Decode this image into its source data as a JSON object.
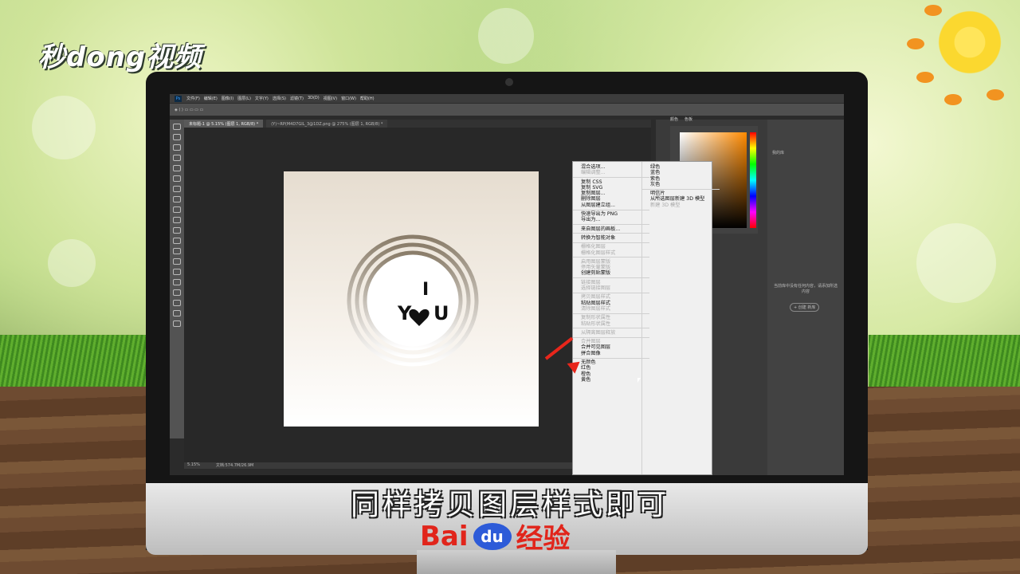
{
  "watermark": {
    "logo": "秒dong视频",
    "baidu_text": "Bai",
    "baidu_paw": "du",
    "baidu_suffix": "经验"
  },
  "subtitle": "同样拷贝图层样式即可",
  "photoshop": {
    "menubar": [
      "文件(F)",
      "编辑(E)",
      "图像(I)",
      "图层(L)",
      "文字(Y)",
      "选择(S)",
      "滤镜(T)",
      "3D(D)",
      "视图(V)",
      "窗口(W)",
      "帮助(H)"
    ],
    "tabs": [
      "未标题-1 @ 5.15% (图层 1, RGB/8) *",
      "(Y)~RP(M4D7GIL_3@1DZ.png @ 275% (图层 1, RGB/8) *"
    ],
    "status_zoom": "5.15%",
    "status_doc": "文档:574.7M/26.9M",
    "document_text": {
      "top": "I",
      "bottom": "Y",
      "bottom2": "U"
    },
    "color_tabs": [
      "颜色",
      "色板"
    ],
    "library_label": "我的库",
    "library_hint": "当前库中没有任何内容，请添加所选内容",
    "library_button": "+ 创建 新库",
    "context_menu_left": [
      {
        "label": "混合选项...",
        "enabled": true
      },
      {
        "label": "编辑调整...",
        "enabled": false
      },
      {
        "sep": true
      },
      {
        "label": "复制 CSS",
        "enabled": true
      },
      {
        "label": "复制 SVG",
        "enabled": true
      },
      {
        "label": "复制图层...",
        "enabled": true
      },
      {
        "label": "删除图层",
        "enabled": true
      },
      {
        "label": "从图层建立组...",
        "enabled": true
      },
      {
        "sep": true
      },
      {
        "label": "快速导出为 PNG",
        "enabled": true
      },
      {
        "label": "导出为...",
        "enabled": true
      },
      {
        "sep": true
      },
      {
        "label": "来自图层的画板...",
        "enabled": true
      },
      {
        "sep": true
      },
      {
        "label": "转换为智能对象",
        "enabled": true
      },
      {
        "sep": true
      },
      {
        "label": "栅格化图层",
        "enabled": false
      },
      {
        "label": "栅格化图层样式",
        "enabled": false
      },
      {
        "sep": true
      },
      {
        "label": "启用图层蒙版",
        "enabled": false
      },
      {
        "label": "停用矢量蒙版",
        "enabled": false
      },
      {
        "label": "创建剪贴蒙版",
        "enabled": true
      },
      {
        "sep": true
      },
      {
        "label": "链接图层",
        "enabled": false
      },
      {
        "label": "选择链接图层",
        "enabled": false
      },
      {
        "sep": true
      },
      {
        "label": "拷贝图层样式",
        "enabled": false
      },
      {
        "label": "粘贴图层样式",
        "enabled": true
      },
      {
        "label": "清除图层样式",
        "enabled": false
      },
      {
        "sep": true
      },
      {
        "label": "复制形状属性",
        "enabled": false
      },
      {
        "label": "粘贴形状属性",
        "enabled": false
      },
      {
        "sep": true
      },
      {
        "label": "从隔离图层释放",
        "enabled": false
      },
      {
        "sep": true
      },
      {
        "label": "合并图层",
        "enabled": false
      },
      {
        "label": "合并可见图层",
        "enabled": true
      },
      {
        "label": "拼合图像",
        "enabled": true
      },
      {
        "sep": true
      },
      {
        "label": "无颜色",
        "enabled": true
      },
      {
        "label": "红色",
        "enabled": true
      },
      {
        "label": "橙色",
        "enabled": true
      },
      {
        "label": "黄色",
        "enabled": true
      }
    ],
    "context_menu_right": [
      {
        "label": "绿色",
        "enabled": true
      },
      {
        "label": "蓝色",
        "enabled": true
      },
      {
        "label": "紫色",
        "enabled": true
      },
      {
        "label": "灰色",
        "enabled": true
      },
      {
        "sep": true
      },
      {
        "label": "明信片",
        "enabled": true
      },
      {
        "label": "从所选图层新建 3D 模型",
        "enabled": true
      },
      {
        "label": "新建 3D 模型",
        "enabled": false
      }
    ],
    "accent_arrow_color": "#e8261b"
  }
}
